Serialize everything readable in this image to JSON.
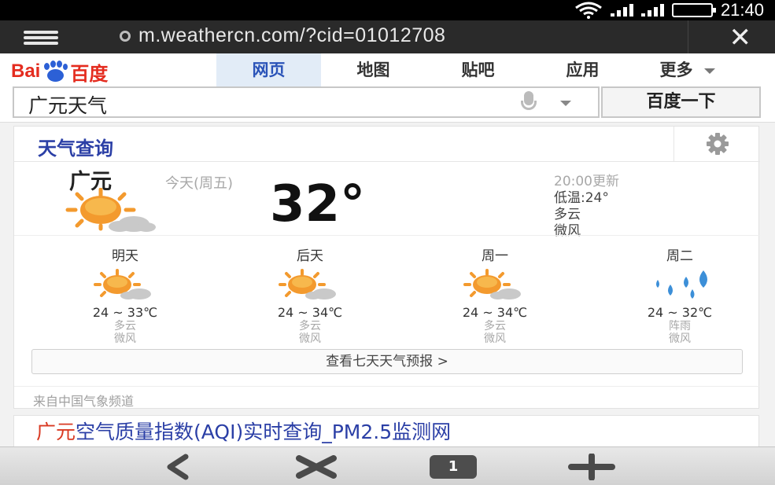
{
  "status_bar": {
    "time": "21:40"
  },
  "browser": {
    "url": "m.weathercn.com/?cid=01012708"
  },
  "baidu": {
    "logo_left": "Bai",
    "logo_right": "百度",
    "tabs": [
      {
        "label": "网页"
      },
      {
        "label": "地图"
      },
      {
        "label": "贴吧"
      },
      {
        "label": "应用"
      },
      {
        "label": "更多"
      }
    ],
    "search_value": "广元天气",
    "search_button": "百度一下"
  },
  "weather": {
    "title": "天气查询",
    "city": "广元",
    "today_label": "今天(周五)",
    "current_temp": "32°",
    "updated": "20:00更新",
    "low": "低温:24°",
    "condition": "多云",
    "wind": "微风",
    "forecast": [
      {
        "day": "明天",
        "range": "24 ~ 33℃",
        "condition": "多云",
        "wind": "微风",
        "icon": "partly-cloudy-icon"
      },
      {
        "day": "后天",
        "range": "24 ~ 34℃",
        "condition": "多云",
        "wind": "微风",
        "icon": "partly-cloudy-icon"
      },
      {
        "day": "周一",
        "range": "24 ~ 34℃",
        "condition": "多云",
        "wind": "微风",
        "icon": "partly-cloudy-icon"
      },
      {
        "day": "周二",
        "range": "24 ~ 32℃",
        "condition": "阵雨",
        "wind": "微风",
        "icon": "rain-icon"
      }
    ],
    "seven_day_button": "查看七天天气预报 >",
    "source": "来自中国气象频道"
  },
  "result2": {
    "highlight": "广元",
    "title_rest": "空气质量指数(AQI)实时查询_PM2.5监测网"
  },
  "toolbar": {
    "tab_count": "1"
  },
  "colors": {
    "accent_blue": "#2b3fa6",
    "baidu_red": "#e42c1f",
    "baidu_blue": "#2c60d6",
    "loading_orange": "#f2a12b",
    "sun_orange": "#f39a2e"
  }
}
